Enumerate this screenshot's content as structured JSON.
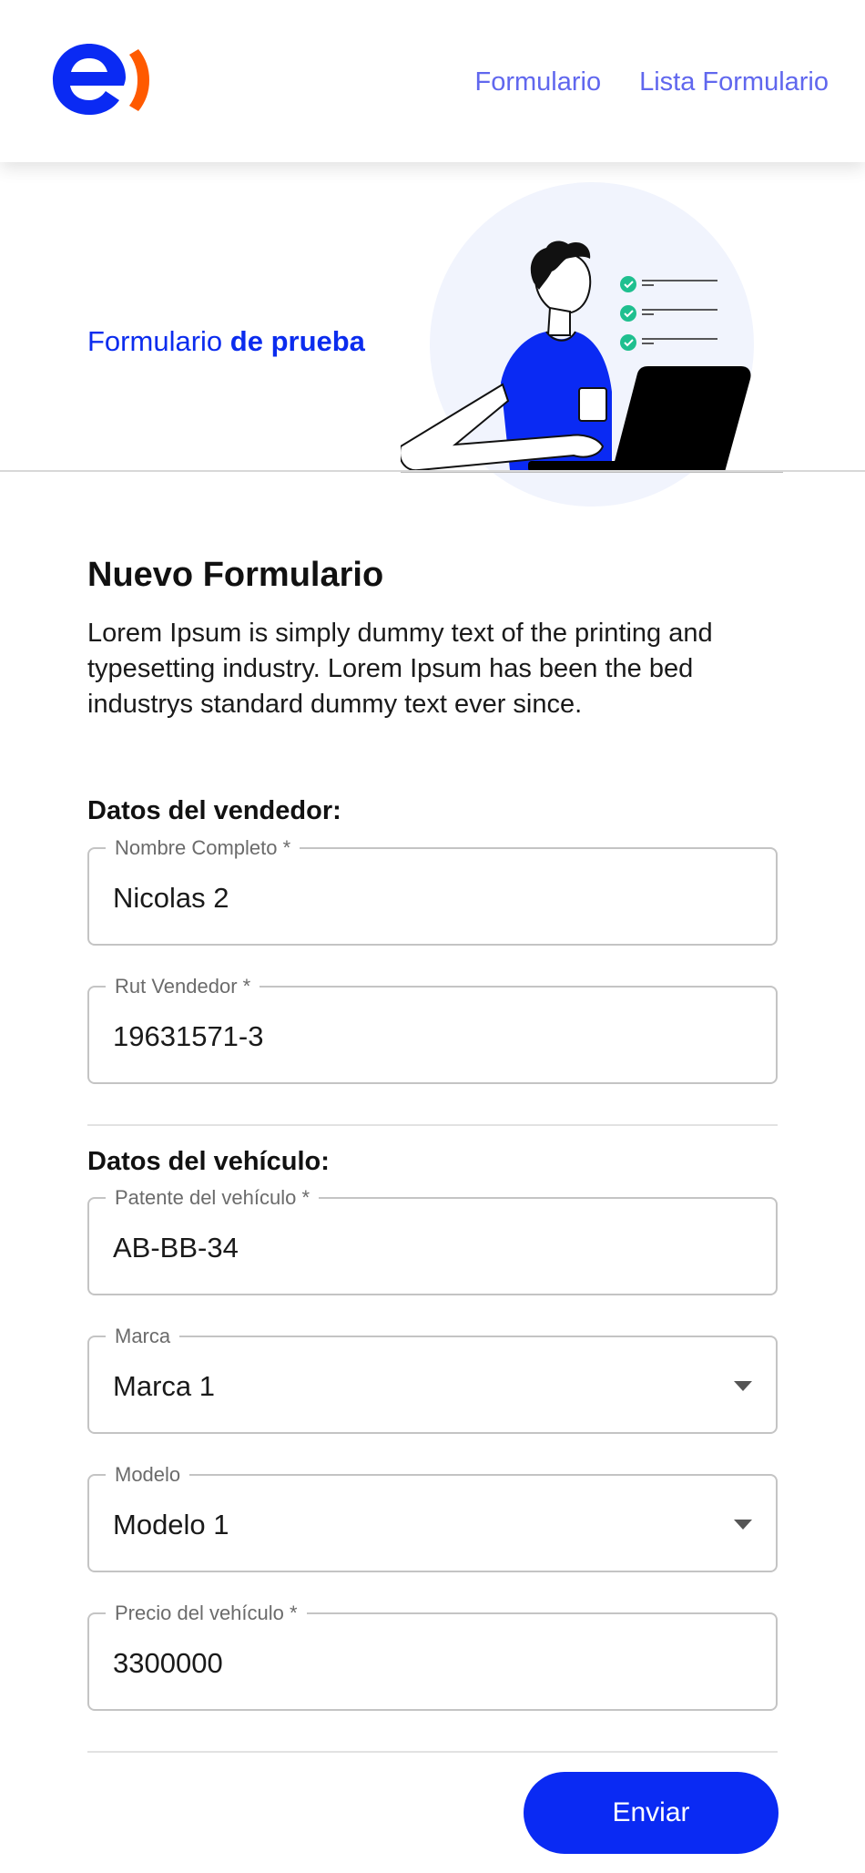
{
  "nav": {
    "items": [
      {
        "label": "Formulario"
      },
      {
        "label": "Lista Formulario"
      }
    ]
  },
  "hero": {
    "title_regular": "Formulario",
    "title_bold": "de prueba"
  },
  "form": {
    "title": "Nuevo Formulario",
    "description": "Lorem Ipsum is simply dummy text of the printing and typesetting industry. Lorem Ipsum has been the bed industrys standard dummy text ever since.",
    "seller": {
      "heading": "Datos del vendedor:",
      "name": {
        "label": "Nombre Completo *",
        "value": "Nicolas 2"
      },
      "rut": {
        "label": "Rut Vendedor *",
        "value": "19631571-3"
      }
    },
    "vehicle": {
      "heading": "Datos del vehículo:",
      "plate": {
        "label": "Patente del vehículo *",
        "value": "AB-BB-34"
      },
      "brand": {
        "label": "Marca",
        "value": "Marca 1"
      },
      "model": {
        "label": "Modelo",
        "value": "Modelo 1"
      },
      "price": {
        "label": "Precio del vehículo *",
        "value": "3300000"
      }
    },
    "submit_label": "Enviar"
  },
  "colors": {
    "brand_blue": "#0a2af3",
    "brand_orange": "#ff5a00",
    "nav_link": "#6067ee",
    "check_green": "#1fbf8f"
  },
  "icons": {
    "logo": "entel-logo",
    "dropdown": "caret-down-icon",
    "illustration": "person-laptop-checklist-illustration"
  }
}
